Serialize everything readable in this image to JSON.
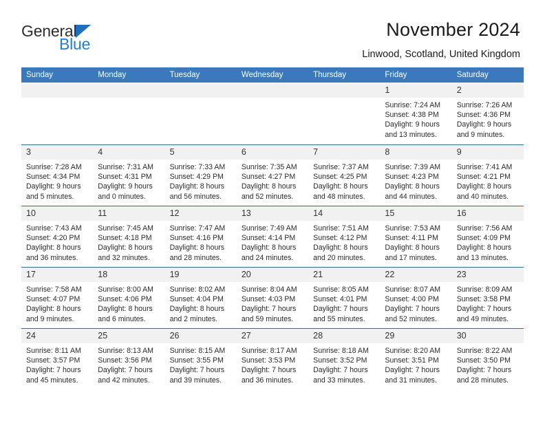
{
  "logo": {
    "word1": "General",
    "word2": "Blue",
    "triangle_color": "#1f6fc0",
    "word2_color": "#1f7fd4",
    "icon": "general-blue-logo"
  },
  "header": {
    "title": "November 2024",
    "subtitle": "Linwood, Scotland, United Kingdom"
  },
  "theme": {
    "header_bg": "#3b79bd",
    "header_text": "#ffffff",
    "daynum_bg": "#f1f1f1",
    "rule_color": "#2f6aa8"
  },
  "weekday_headers": [
    "Sunday",
    "Monday",
    "Tuesday",
    "Wednesday",
    "Thursday",
    "Friday",
    "Saturday"
  ],
  "weeks": [
    [
      {
        "day": "",
        "lines": []
      },
      {
        "day": "",
        "lines": []
      },
      {
        "day": "",
        "lines": []
      },
      {
        "day": "",
        "lines": []
      },
      {
        "day": "",
        "lines": []
      },
      {
        "day": "1",
        "lines": [
          "Sunrise: 7:24 AM",
          "Sunset: 4:38 PM",
          "Daylight: 9 hours",
          "and 13 minutes."
        ]
      },
      {
        "day": "2",
        "lines": [
          "Sunrise: 7:26 AM",
          "Sunset: 4:36 PM",
          "Daylight: 9 hours",
          "and 9 minutes."
        ]
      }
    ],
    [
      {
        "day": "3",
        "lines": [
          "Sunrise: 7:28 AM",
          "Sunset: 4:34 PM",
          "Daylight: 9 hours",
          "and 5 minutes."
        ]
      },
      {
        "day": "4",
        "lines": [
          "Sunrise: 7:31 AM",
          "Sunset: 4:31 PM",
          "Daylight: 9 hours",
          "and 0 minutes."
        ]
      },
      {
        "day": "5",
        "lines": [
          "Sunrise: 7:33 AM",
          "Sunset: 4:29 PM",
          "Daylight: 8 hours",
          "and 56 minutes."
        ]
      },
      {
        "day": "6",
        "lines": [
          "Sunrise: 7:35 AM",
          "Sunset: 4:27 PM",
          "Daylight: 8 hours",
          "and 52 minutes."
        ]
      },
      {
        "day": "7",
        "lines": [
          "Sunrise: 7:37 AM",
          "Sunset: 4:25 PM",
          "Daylight: 8 hours",
          "and 48 minutes."
        ]
      },
      {
        "day": "8",
        "lines": [
          "Sunrise: 7:39 AM",
          "Sunset: 4:23 PM",
          "Daylight: 8 hours",
          "and 44 minutes."
        ]
      },
      {
        "day": "9",
        "lines": [
          "Sunrise: 7:41 AM",
          "Sunset: 4:21 PM",
          "Daylight: 8 hours",
          "and 40 minutes."
        ]
      }
    ],
    [
      {
        "day": "10",
        "lines": [
          "Sunrise: 7:43 AM",
          "Sunset: 4:20 PM",
          "Daylight: 8 hours",
          "and 36 minutes."
        ]
      },
      {
        "day": "11",
        "lines": [
          "Sunrise: 7:45 AM",
          "Sunset: 4:18 PM",
          "Daylight: 8 hours",
          "and 32 minutes."
        ]
      },
      {
        "day": "12",
        "lines": [
          "Sunrise: 7:47 AM",
          "Sunset: 4:16 PM",
          "Daylight: 8 hours",
          "and 28 minutes."
        ]
      },
      {
        "day": "13",
        "lines": [
          "Sunrise: 7:49 AM",
          "Sunset: 4:14 PM",
          "Daylight: 8 hours",
          "and 24 minutes."
        ]
      },
      {
        "day": "14",
        "lines": [
          "Sunrise: 7:51 AM",
          "Sunset: 4:12 PM",
          "Daylight: 8 hours",
          "and 20 minutes."
        ]
      },
      {
        "day": "15",
        "lines": [
          "Sunrise: 7:53 AM",
          "Sunset: 4:11 PM",
          "Daylight: 8 hours",
          "and 17 minutes."
        ]
      },
      {
        "day": "16",
        "lines": [
          "Sunrise: 7:56 AM",
          "Sunset: 4:09 PM",
          "Daylight: 8 hours",
          "and 13 minutes."
        ]
      }
    ],
    [
      {
        "day": "17",
        "lines": [
          "Sunrise: 7:58 AM",
          "Sunset: 4:07 PM",
          "Daylight: 8 hours",
          "and 9 minutes."
        ]
      },
      {
        "day": "18",
        "lines": [
          "Sunrise: 8:00 AM",
          "Sunset: 4:06 PM",
          "Daylight: 8 hours",
          "and 6 minutes."
        ]
      },
      {
        "day": "19",
        "lines": [
          "Sunrise: 8:02 AM",
          "Sunset: 4:04 PM",
          "Daylight: 8 hours",
          "and 2 minutes."
        ]
      },
      {
        "day": "20",
        "lines": [
          "Sunrise: 8:04 AM",
          "Sunset: 4:03 PM",
          "Daylight: 7 hours",
          "and 59 minutes."
        ]
      },
      {
        "day": "21",
        "lines": [
          "Sunrise: 8:05 AM",
          "Sunset: 4:01 PM",
          "Daylight: 7 hours",
          "and 55 minutes."
        ]
      },
      {
        "day": "22",
        "lines": [
          "Sunrise: 8:07 AM",
          "Sunset: 4:00 PM",
          "Daylight: 7 hours",
          "and 52 minutes."
        ]
      },
      {
        "day": "23",
        "lines": [
          "Sunrise: 8:09 AM",
          "Sunset: 3:58 PM",
          "Daylight: 7 hours",
          "and 49 minutes."
        ]
      }
    ],
    [
      {
        "day": "24",
        "lines": [
          "Sunrise: 8:11 AM",
          "Sunset: 3:57 PM",
          "Daylight: 7 hours",
          "and 45 minutes."
        ]
      },
      {
        "day": "25",
        "lines": [
          "Sunrise: 8:13 AM",
          "Sunset: 3:56 PM",
          "Daylight: 7 hours",
          "and 42 minutes."
        ]
      },
      {
        "day": "26",
        "lines": [
          "Sunrise: 8:15 AM",
          "Sunset: 3:55 PM",
          "Daylight: 7 hours",
          "and 39 minutes."
        ]
      },
      {
        "day": "27",
        "lines": [
          "Sunrise: 8:17 AM",
          "Sunset: 3:53 PM",
          "Daylight: 7 hours",
          "and 36 minutes."
        ]
      },
      {
        "day": "28",
        "lines": [
          "Sunrise: 8:18 AM",
          "Sunset: 3:52 PM",
          "Daylight: 7 hours",
          "and 33 minutes."
        ]
      },
      {
        "day": "29",
        "lines": [
          "Sunrise: 8:20 AM",
          "Sunset: 3:51 PM",
          "Daylight: 7 hours",
          "and 31 minutes."
        ]
      },
      {
        "day": "30",
        "lines": [
          "Sunrise: 8:22 AM",
          "Sunset: 3:50 PM",
          "Daylight: 7 hours",
          "and 28 minutes."
        ]
      }
    ]
  ]
}
